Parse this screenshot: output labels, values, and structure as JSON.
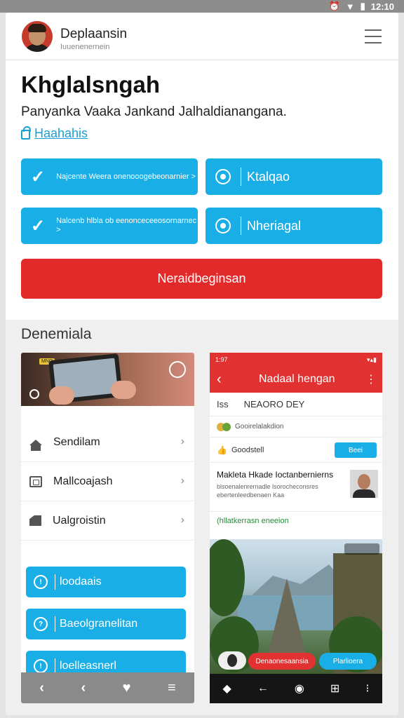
{
  "status_bar": {
    "time": "12:10",
    "icons": [
      "alarm-icon",
      "sync-icon",
      "wifi-icon",
      "signal-icon",
      "battery-icon"
    ]
  },
  "header": {
    "app_name": "Deplaansin",
    "app_sub": "Iuuenenernein"
  },
  "main": {
    "title": "Khglalsngah",
    "subtitle": "Panyanka Vaaka Jankand Jalhaldianangana.",
    "link": "Haahahis",
    "buttons": [
      {
        "label": "Najcente Weera onenooogebeonarnier >",
        "icon": "check-icon"
      },
      {
        "label": "Ktalqao",
        "icon": "gear-icon"
      },
      {
        "label": "Nalcenb hlbla ob eenonceceeosornarnec >",
        "icon": "check-icon"
      },
      {
        "label": "Nheriagal",
        "icon": "gear-icon"
      }
    ],
    "primary_button": "Neraidbeginsan"
  },
  "section": {
    "title": "Denemiala"
  },
  "left_panel": {
    "photo_tag": "MNO",
    "list": [
      {
        "label": "Sendilam",
        "icon": "home-icon"
      },
      {
        "label": "Mallcoajash",
        "icon": "image-icon"
      },
      {
        "label": "Ualgroistin",
        "icon": "building-icon"
      }
    ],
    "actions": [
      {
        "label": "loodaais",
        "icon": "info-icon",
        "glyph": "!"
      },
      {
        "label": "Baeolgranelitan",
        "icon": "chat-icon",
        "glyph": "?"
      },
      {
        "label": "loelleasnerl",
        "icon": "alert-icon",
        "glyph": "!"
      }
    ],
    "nav": [
      "‹",
      "‹",
      "♥",
      "≡"
    ]
  },
  "right_panel": {
    "status_time": "1:97",
    "title": "Nadaal hengan",
    "row1_key": "Iss",
    "row1_value": "NEAORO DEY",
    "row2_text": "Gooirelalakdion",
    "row3_text": "Goodstell",
    "row3_button": "Beei",
    "card_title": "Makleta Hkade Ioctanbernierns",
    "card_desc": "blsoenalenrernadle lsorocheconsres ebertenleedbenaen Kaa",
    "link": "(hllatkerrasn eneeion",
    "pill_red": "Denaonesaansia",
    "pill_blue": "Plarlioera",
    "nav": [
      "◆",
      "←",
      "◉",
      "⊞",
      "⁝"
    ]
  },
  "colors": {
    "accent_blue": "#1aaee6",
    "accent_red": "#e22a2a",
    "link_blue": "#1a9fd6"
  }
}
